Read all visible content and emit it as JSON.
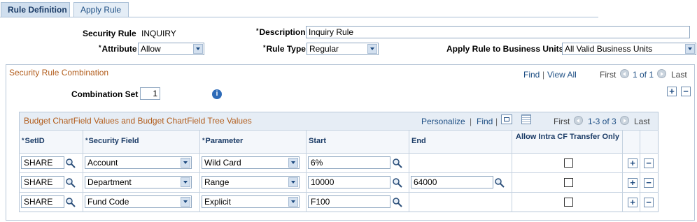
{
  "tabs": [
    {
      "label": "Rule Definition"
    },
    {
      "label": "Apply Rule"
    }
  ],
  "header": {
    "security_rule_label": "Security Rule",
    "security_rule_value": "INQUIRY",
    "description_label": "Description",
    "description_value": "Inquiry Rule",
    "attribute_label": "Attribute",
    "attribute_value": "Allow",
    "rule_type_label": "Rule Type",
    "rule_type_value": "Regular",
    "apply_rule_label": "Apply Rule to Business Units",
    "apply_rule_value": "All Valid Business Units",
    "required_marker": "*"
  },
  "combination_section": {
    "title": "Security Rule Combination",
    "find": "Find",
    "separator": "|",
    "view_all": "View All",
    "first": "First",
    "range": "1 of 1",
    "last": "Last",
    "combination_set_label": "Combination Set",
    "combination_set_value": "1"
  },
  "grid": {
    "title": "Budget ChartField Values and Budget ChartField Tree Values",
    "personalize": "Personalize",
    "find": "Find",
    "separator": "|",
    "first": "First",
    "range": "1-3 of 3",
    "last": "Last",
    "columns": {
      "setid": "SetID",
      "security_field": "Security Field",
      "parameter": "Parameter",
      "start": "Start",
      "end": "End",
      "allow_intra": "Allow Intra CF Transfer Only"
    },
    "rows": [
      {
        "setid": "SHARE",
        "security_field": "Account",
        "parameter": "Wild Card",
        "start": "6%",
        "end": "",
        "allow_intra": false
      },
      {
        "setid": "SHARE",
        "security_field": "Department",
        "parameter": "Range",
        "start": "10000",
        "end": "64000",
        "allow_intra": false
      },
      {
        "setid": "SHARE",
        "security_field": "Fund Code",
        "parameter": "Explicit",
        "start": "F100",
        "end": "",
        "allow_intra": false
      }
    ]
  },
  "buttons": {
    "add": "+",
    "delete": "−"
  },
  "colors": {
    "section_title": "#b25d1c",
    "link": "#1e4f84",
    "grid_header": "#1a3b66"
  }
}
